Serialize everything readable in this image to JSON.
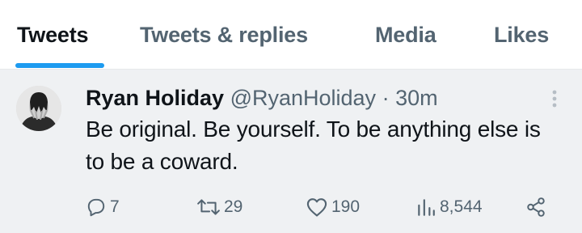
{
  "tabs": [
    {
      "label": "Tweets",
      "active": true
    },
    {
      "label": "Tweets & replies",
      "active": false
    },
    {
      "label": "Media",
      "active": false
    },
    {
      "label": "Likes",
      "active": false
    }
  ],
  "tweet": {
    "author_name": "Ryan Holiday",
    "author_handle": "@RyanHoliday",
    "separator": "·",
    "time": "30m",
    "text": "Be original. Be yourself. To be anything else is to be a coward.",
    "actions": {
      "replies": "7",
      "retweets": "29",
      "likes": "190",
      "views": "8,544"
    },
    "icons": {
      "reply": "reply-icon",
      "retweet": "retweet-icon",
      "like": "heart-icon",
      "views": "views-icon",
      "share": "share-icon",
      "more": "more-vertical-icon"
    }
  },
  "colors": {
    "accent": "#1d9bf0",
    "text_primary": "#0f1419",
    "text_secondary": "#536471",
    "tweet_background": "#eff1f3"
  }
}
